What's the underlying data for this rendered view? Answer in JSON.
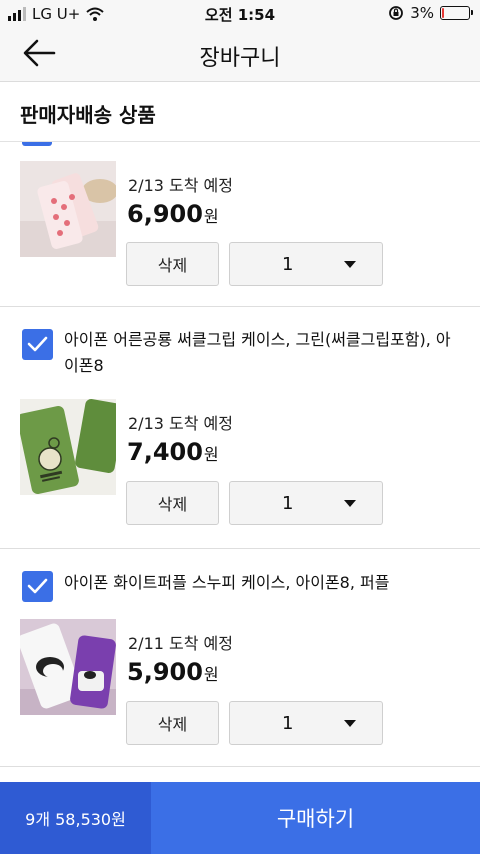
{
  "status_bar": {
    "carrier": "LG U+",
    "time": "오전 1:54",
    "battery_percent": "3%",
    "battery_level": 0.03,
    "battery_color": "#e53935"
  },
  "header": {
    "title": "장바구니",
    "back_icon": "arrow-left-icon"
  },
  "section": {
    "title": "판매자배송 상품"
  },
  "items": [
    {
      "name": "",
      "arrival": "2/13 도착 예정",
      "price": "6,900",
      "currency": "원",
      "delete_label": "삭제",
      "quantity": "1",
      "thumb_color": "pink-peach-phone-case"
    },
    {
      "name": "아이폰 어른공룡 써클그립 케이스, 그린(써클그립포함), 아이폰8",
      "arrival": "2/13 도착 예정",
      "price": "7,400",
      "currency": "원",
      "delete_label": "삭제",
      "quantity": "1",
      "checked": true,
      "thumb_color": "green-dinosaur-phone-case"
    },
    {
      "name": "아이폰 화이트퍼플 스누피 케이스, 아이폰8, 퍼플",
      "arrival": "2/11 도착 예정",
      "price": "5,900",
      "currency": "원",
      "delete_label": "삭제",
      "quantity": "1",
      "checked": true,
      "thumb_color": "purple-snoopy-phone-case"
    }
  ],
  "bottom": {
    "summary": "9개 58,530원",
    "buy_label": "구매하기"
  },
  "colors": {
    "accent": "#3b6fe6",
    "accent_dark": "#2f5bd3"
  }
}
